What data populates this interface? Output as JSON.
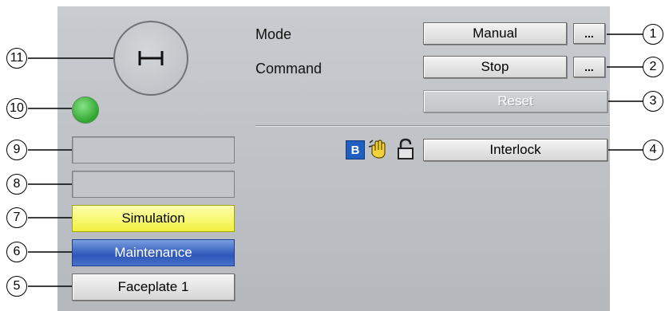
{
  "mode": {
    "label": "Mode",
    "value": "Manual",
    "more": "..."
  },
  "command": {
    "label": "Command",
    "value": "Stop",
    "more": "..."
  },
  "reset": {
    "label": "Reset"
  },
  "interlock": {
    "label": "Interlock",
    "badge_letter": "B",
    "icons": [
      "operator-hand-icon",
      "open-lock-icon"
    ]
  },
  "status_fields": {
    "simulation": "Simulation",
    "maintenance": "Maintenance",
    "faceplate": "Faceplate 1"
  },
  "indicator_color": "#3fb83f",
  "callouts": [
    "1",
    "2",
    "3",
    "4",
    "5",
    "6",
    "7",
    "8",
    "9",
    "10",
    "11"
  ]
}
